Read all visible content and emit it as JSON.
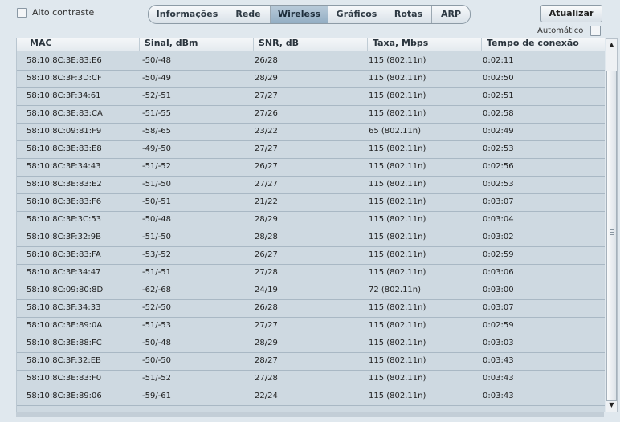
{
  "high_contrast": {
    "label": "Alto contraste",
    "checked": false
  },
  "tabs": [
    {
      "label": "Informações",
      "active": false
    },
    {
      "label": "Rede",
      "active": false
    },
    {
      "label": "Wireless",
      "active": true
    },
    {
      "label": "Gráficos",
      "active": false
    },
    {
      "label": "Rotas",
      "active": false
    },
    {
      "label": "ARP",
      "active": false
    }
  ],
  "update_button": {
    "label": "Atualizar"
  },
  "auto_refresh": {
    "label": "Automático",
    "checked": false
  },
  "table": {
    "columns": [
      "MAC",
      "Sinal, dBm",
      "SNR, dB",
      "Taxa, Mbps",
      "Tempo de conexão"
    ],
    "rows": [
      [
        "58:10:8C:3E:83:E6",
        "-50/-48",
        "26/28",
        "115 (802.11n)",
        "0:02:11"
      ],
      [
        "58:10:8C:3F:3D:CF",
        "-50/-49",
        "28/29",
        "115 (802.11n)",
        "0:02:50"
      ],
      [
        "58:10:8C:3F:34:61",
        "-52/-51",
        "27/27",
        "115 (802.11n)",
        "0:02:51"
      ],
      [
        "58:10:8C:3E:83:CA",
        "-51/-55",
        "27/26",
        "115 (802.11n)",
        "0:02:58"
      ],
      [
        "58:10:8C:09:81:F9",
        "-58/-65",
        "23/22",
        "65 (802.11n)",
        "0:02:49"
      ],
      [
        "58:10:8C:3E:83:E8",
        "-49/-50",
        "27/27",
        "115 (802.11n)",
        "0:02:53"
      ],
      [
        "58:10:8C:3F:34:43",
        "-51/-52",
        "26/27",
        "115 (802.11n)",
        "0:02:56"
      ],
      [
        "58:10:8C:3E:83:E2",
        "-51/-50",
        "27/27",
        "115 (802.11n)",
        "0:02:53"
      ],
      [
        "58:10:8C:3E:83:F6",
        "-50/-51",
        "21/22",
        "115 (802.11n)",
        "0:03:07"
      ],
      [
        "58:10:8C:3F:3C:53",
        "-50/-48",
        "28/29",
        "115 (802.11n)",
        "0:03:04"
      ],
      [
        "58:10:8C:3F:32:9B",
        "-51/-50",
        "28/28",
        "115 (802.11n)",
        "0:03:02"
      ],
      [
        "58:10:8C:3E:83:FA",
        "-53/-52",
        "26/27",
        "115 (802.11n)",
        "0:02:59"
      ],
      [
        "58:10:8C:3F:34:47",
        "-51/-51",
        "27/28",
        "115 (802.11n)",
        "0:03:06"
      ],
      [
        "58:10:8C:09:80:8D",
        "-62/-68",
        "24/19",
        "72 (802.11n)",
        "0:03:00"
      ],
      [
        "58:10:8C:3F:34:33",
        "-52/-50",
        "26/28",
        "115 (802.11n)",
        "0:03:07"
      ],
      [
        "58:10:8C:3E:89:0A",
        "-51/-53",
        "27/27",
        "115 (802.11n)",
        "0:02:59"
      ],
      [
        "58:10:8C:3E:88:FC",
        "-50/-48",
        "28/29",
        "115 (802.11n)",
        "0:03:03"
      ],
      [
        "58:10:8C:3F:32:EB",
        "-50/-50",
        "28/27",
        "115 (802.11n)",
        "0:03:43"
      ],
      [
        "58:10:8C:3E:83:F0",
        "-51/-52",
        "27/28",
        "115 (802.11n)",
        "0:03:43"
      ],
      [
        "58:10:8C:3E:89:06",
        "-59/-61",
        "22/24",
        "115 (802.11n)",
        "0:03:43"
      ]
    ]
  },
  "scrollbar": {
    "up_glyph": "▲",
    "down_glyph": "▼"
  },
  "colors": {
    "active_tab": "#a3bace",
    "panel_bg": "#ced9e1",
    "page_bg": "#e0e8ee"
  }
}
